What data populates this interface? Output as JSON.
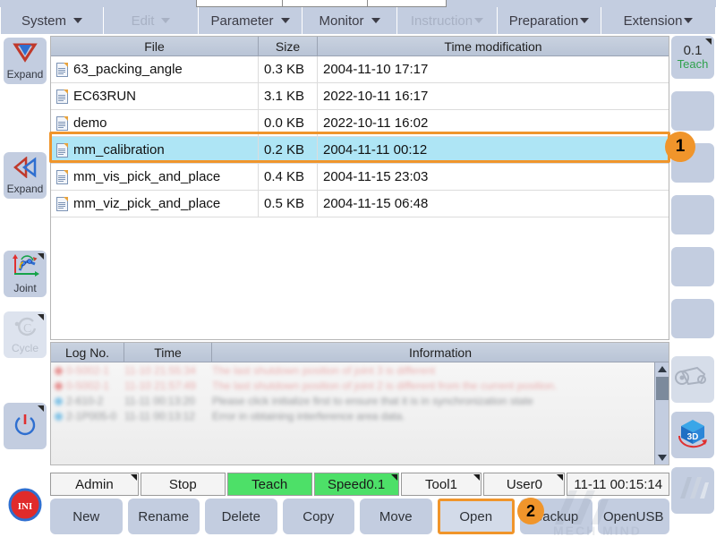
{
  "menubar": {
    "items": [
      {
        "label": "System",
        "disabled": false,
        "caret": true
      },
      {
        "label": "Edit",
        "disabled": true,
        "caret": true
      },
      {
        "label": "Parameter",
        "disabled": false,
        "caret": true
      },
      {
        "label": "Monitor",
        "disabled": false,
        "caret": true
      },
      {
        "label": "Instruction",
        "disabled": true,
        "caret": true
      },
      {
        "label": "Preparation",
        "disabled": false,
        "caret": true
      },
      {
        "label": "Extension",
        "disabled": false,
        "caret": true
      }
    ]
  },
  "left_rail": {
    "items": [
      {
        "label": "Expand",
        "icon": "expand-down-icon",
        "dim": false,
        "corner": false
      },
      {
        "label": "Expand",
        "icon": "expand-left-icon",
        "dim": false,
        "corner": false
      },
      {
        "label": "Joint",
        "icon": "joint-coord-icon",
        "dim": false,
        "corner": true
      },
      {
        "label": "Cycle",
        "icon": "cycle-icon",
        "dim": true,
        "corner": true
      },
      {
        "label": "",
        "icon": "power-icon",
        "dim": false,
        "corner": true
      },
      {
        "label": "",
        "icon": "ini-icon",
        "dim": false,
        "corner": false
      }
    ],
    "ini_text": "INI"
  },
  "right_rail": {
    "teach": {
      "value": "0.1",
      "label": "Teach",
      "corner": true
    },
    "blank_count": 5,
    "robot_icon": "robot-arm-icon",
    "view3d_icon": "3d-view-icon",
    "view3d_text": "3D",
    "logo_icon": "mech-mind-logo-icon"
  },
  "file_table": {
    "columns": [
      "File",
      "Size",
      "Time modification"
    ],
    "rows": [
      {
        "file": "63_packing_angle",
        "size": "0.3 KB",
        "time": "2004-11-10 17:17",
        "selected": false
      },
      {
        "file": "EC63RUN",
        "size": "3.1 KB",
        "time": "2022-10-11 16:17",
        "selected": false
      },
      {
        "file": "demo",
        "size": "0.0 KB",
        "time": "2022-10-11 16:02",
        "selected": false
      },
      {
        "file": "mm_calibration",
        "size": "0.2 KB",
        "time": "2004-11-11 00:12",
        "selected": true
      },
      {
        "file": "mm_vis_pick_and_place",
        "size": "0.4 KB",
        "time": "2004-11-15 23:03",
        "selected": false
      },
      {
        "file": "mm_viz_pick_and_place",
        "size": "0.5 KB",
        "time": "2004-11-15 06:48",
        "selected": false
      }
    ]
  },
  "log_panel": {
    "columns": [
      "Log No.",
      "Time",
      "Information"
    ],
    "rows": [
      {
        "no": "2-1P005-0",
        "time": "11-11 00:13:12",
        "info": "Error in obtaining interference area data.",
        "level": "info"
      },
      {
        "no": "2-610-2",
        "time": "11-11 00:13:20",
        "info": "Please click initialize first to ensure that it is in synchronization state",
        "level": "info"
      },
      {
        "no": "0-5002-1",
        "time": "11-10 21:57:49",
        "info": "The last shutdown position of joint 2 is different from the current position.",
        "level": "err"
      },
      {
        "no": "0-5002-1",
        "time": "11-10 21:55:34",
        "info": "The last shutdown position of joint 3 is different",
        "level": "err"
      }
    ]
  },
  "status_bar": {
    "cells": [
      {
        "label": "Admin",
        "highlight": false,
        "corner": true
      },
      {
        "label": "Stop",
        "highlight": false,
        "corner": false
      },
      {
        "label": "Teach",
        "highlight": true,
        "corner": false
      },
      {
        "label": "Speed0.1",
        "highlight": true,
        "corner": true
      },
      {
        "label": "Tool1",
        "highlight": false,
        "corner": true
      },
      {
        "label": "User0",
        "highlight": false,
        "corner": true
      },
      {
        "label": "11-11 00:15:14",
        "highlight": false,
        "corner": false
      }
    ]
  },
  "bottom_toolbar": {
    "buttons": [
      {
        "label": "New",
        "active": false
      },
      {
        "label": "Rename",
        "active": false
      },
      {
        "label": "Delete",
        "active": false
      },
      {
        "label": "Copy",
        "active": false
      },
      {
        "label": "Move",
        "active": false
      },
      {
        "label": "Open",
        "active": true
      },
      {
        "label": "Backup",
        "active": false
      },
      {
        "label": "OpenUSB",
        "active": false
      }
    ]
  },
  "annotations": {
    "badge1": "1",
    "badge2": "2"
  },
  "watermark": {
    "text": "MECH MIND"
  },
  "colors": {
    "accent_orange": "#f0952b",
    "chrome_blue": "#c3cde0",
    "selection_cyan": "#aee5f5",
    "status_green": "#4de068"
  }
}
